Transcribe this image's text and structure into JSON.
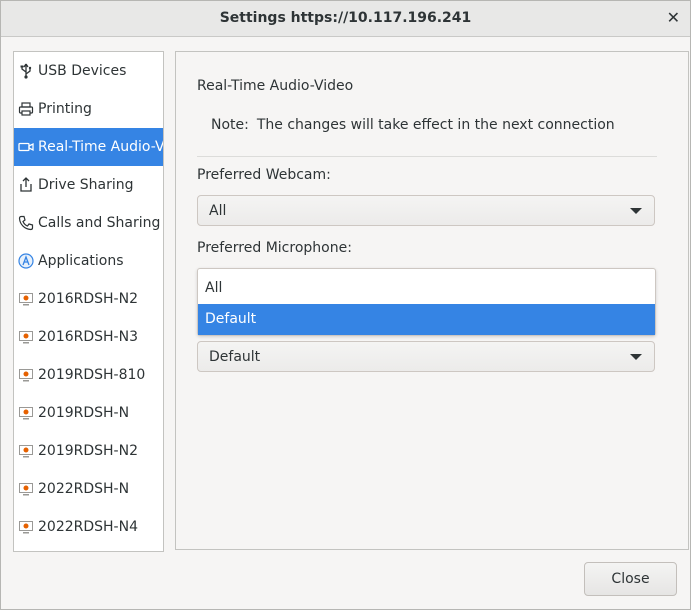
{
  "window": {
    "title": "Settings https://10.117.196.241",
    "close_glyph": "✕"
  },
  "sidebar": {
    "items": [
      {
        "label": "USB Devices",
        "icon": "usb-icon"
      },
      {
        "label": "Printing",
        "icon": "printer-icon"
      },
      {
        "label": "Real-Time Audio-Video",
        "icon": "camera-icon",
        "selected": true
      },
      {
        "label": "Drive Sharing",
        "icon": "share-icon"
      },
      {
        "label": "Calls and Sharing",
        "icon": "phone-icon"
      },
      {
        "label": "Applications",
        "icon": "applications-icon"
      },
      {
        "label": "2016RDSH-N2",
        "icon": "remote-desktop-icon"
      },
      {
        "label": "2016RDSH-N3",
        "icon": "remote-desktop-icon"
      },
      {
        "label": "2019RDSH-810",
        "icon": "remote-desktop-icon"
      },
      {
        "label": "2019RDSH-N",
        "icon": "remote-desktop-icon"
      },
      {
        "label": "2019RDSH-N2",
        "icon": "remote-desktop-icon"
      },
      {
        "label": "2022RDSH-N",
        "icon": "remote-desktop-icon"
      },
      {
        "label": "2022RDSH-N4",
        "icon": "remote-desktop-icon"
      }
    ]
  },
  "panel": {
    "title": "Real-Time Audio-Video",
    "note_label": "Note:",
    "note_text": "The changes will take effect in the next connection",
    "webcam_label": "Preferred Webcam:",
    "webcam_value": "All",
    "microphone_label": "Preferred Microphone:",
    "microphone_options": [
      "All",
      "Default"
    ],
    "microphone_highlighted": "Default",
    "speaker_value": "Default"
  },
  "footer": {
    "close_label": "Close"
  },
  "colors": {
    "accent": "#3584e4",
    "background": "#f6f5f4",
    "titlebar": "#e8e8e7",
    "icon_accent": "#e66100"
  }
}
